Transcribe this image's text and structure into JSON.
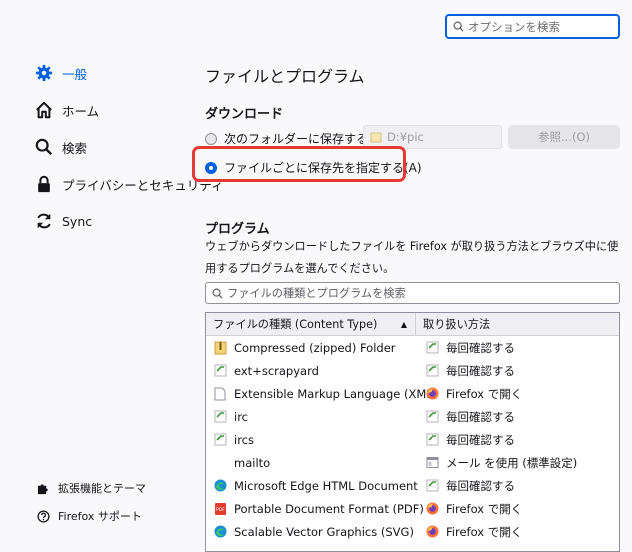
{
  "search": {
    "placeholder": "オプションを検索"
  },
  "sidebar": {
    "items": [
      {
        "label": "一般",
        "icon": "gear-icon"
      },
      {
        "label": "ホーム",
        "icon": "home-icon"
      },
      {
        "label": "検索",
        "icon": "search-icon"
      },
      {
        "label": "プライバシーとセキュリティ",
        "icon": "lock-icon"
      },
      {
        "label": "Sync",
        "icon": "sync-icon"
      }
    ],
    "footer": [
      {
        "label": "拡張機能とテーマ",
        "icon": "puzzle-icon"
      },
      {
        "label": "Firefox サポート",
        "icon": "help-icon"
      }
    ]
  },
  "main": {
    "title": "ファイルとプログラム",
    "downloads": {
      "heading": "ダウンロード",
      "option_save_to": "次のフォルダーに保存する(V)",
      "folder_path": "D:¥pic",
      "browse_label": "参照...(O)",
      "option_ask": "ファイルごとに保存先を指定する(A)"
    },
    "apps": {
      "heading": "プログラム",
      "description": "ウェブからダウンロードしたファイルを Firefox が取り扱う方法とブラウズ中に使用するプログラムを選んでください。",
      "filter_placeholder": "ファイルの種類とプログラムを検索",
      "col_type": "ファイルの種類 (Content Type)",
      "col_action": "取り扱い方法",
      "rows": [
        {
          "type": "Compressed (zipped) Folder",
          "type_icon": "zip-folder-icon",
          "action": "毎回確認する",
          "action_icon": "ask-icon"
        },
        {
          "type": "ext+scrapyard",
          "type_icon": "ask-icon",
          "action": "毎回確認する",
          "action_icon": "ask-icon"
        },
        {
          "type": "Extensible Markup Language (XML)",
          "type_icon": "document-icon",
          "action": "Firefox で開く",
          "action_icon": "firefox-icon"
        },
        {
          "type": "irc",
          "type_icon": "ask-icon",
          "action": "毎回確認する",
          "action_icon": "ask-icon"
        },
        {
          "type": "ircs",
          "type_icon": "ask-icon",
          "action": "毎回確認する",
          "action_icon": "ask-icon"
        },
        {
          "type": "mailto",
          "type_icon": "",
          "action": "メール を使用 (標準設定)",
          "action_icon": "app-icon"
        },
        {
          "type": "Microsoft Edge HTML Document",
          "type_icon": "edge-icon",
          "action": "毎回確認する",
          "action_icon": "ask-icon"
        },
        {
          "type": "Portable Document Format (PDF)",
          "type_icon": "pdf-icon",
          "action": "Firefox で開く",
          "action_icon": "firefox-icon"
        },
        {
          "type": "Scalable Vector Graphics (SVG)",
          "type_icon": "edge-icon",
          "action": "Firefox で開く",
          "action_icon": "firefox-icon"
        }
      ]
    }
  },
  "colors": {
    "accent": "#0061e0",
    "highlight": "#e53935",
    "background": "#f9f9fb"
  }
}
